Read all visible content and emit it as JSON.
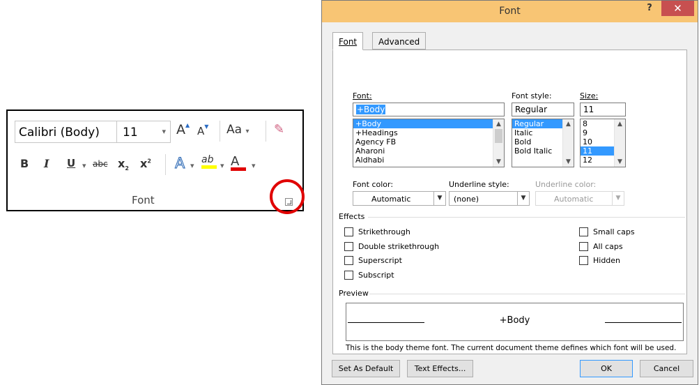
{
  "ribbon": {
    "font_name": "Calibri (Body)",
    "font_size": "11",
    "group_label": "Font",
    "grow_font_glyph": "A",
    "shrink_font_glyph": "A",
    "change_case_label": "Aa",
    "bold_glyph": "B",
    "italic_glyph": "I",
    "underline_glyph": "U",
    "strike_glyph": "abc",
    "subscript_glyph": "x",
    "superscript_glyph": "x",
    "text_effects_glyph": "A",
    "highlight_glyph": "ab",
    "font_color_glyph": "A",
    "highlight_color": "#ffff00",
    "font_color": "#e00000"
  },
  "dialog": {
    "title": "Font",
    "help_glyph": "?",
    "close_glyph": "✕",
    "tabs": [
      "Font",
      "Advanced"
    ],
    "font_label": "Font:",
    "font_value": "+Body",
    "font_list": [
      "+Body",
      "+Headings",
      "Agency FB",
      "Aharoni",
      "Aldhabi"
    ],
    "style_label": "Font style:",
    "style_value": "Regular",
    "style_list": [
      "Regular",
      "Italic",
      "Bold",
      "Bold Italic"
    ],
    "size_label": "Size:",
    "size_value": "11",
    "size_list": [
      "8",
      "9",
      "10",
      "11",
      "12"
    ],
    "font_color_label": "Font color:",
    "font_color_value": "Automatic",
    "underline_style_label": "Underline style:",
    "underline_style_value": "(none)",
    "underline_color_label": "Underline color:",
    "underline_color_value": "Automatic",
    "effects_label": "Effects",
    "effects_left": [
      "Strikethrough",
      "Double strikethrough",
      "Superscript",
      "Subscript"
    ],
    "effects_right": [
      "Small caps",
      "All caps",
      "Hidden"
    ],
    "preview_label": "Preview",
    "preview_text": "+Body",
    "preview_note": "This is the body theme font. The current document theme defines which font will be used.",
    "buttons": {
      "set_default": "Set As Default",
      "text_effects": "Text Effects...",
      "ok": "OK",
      "cancel": "Cancel"
    }
  }
}
